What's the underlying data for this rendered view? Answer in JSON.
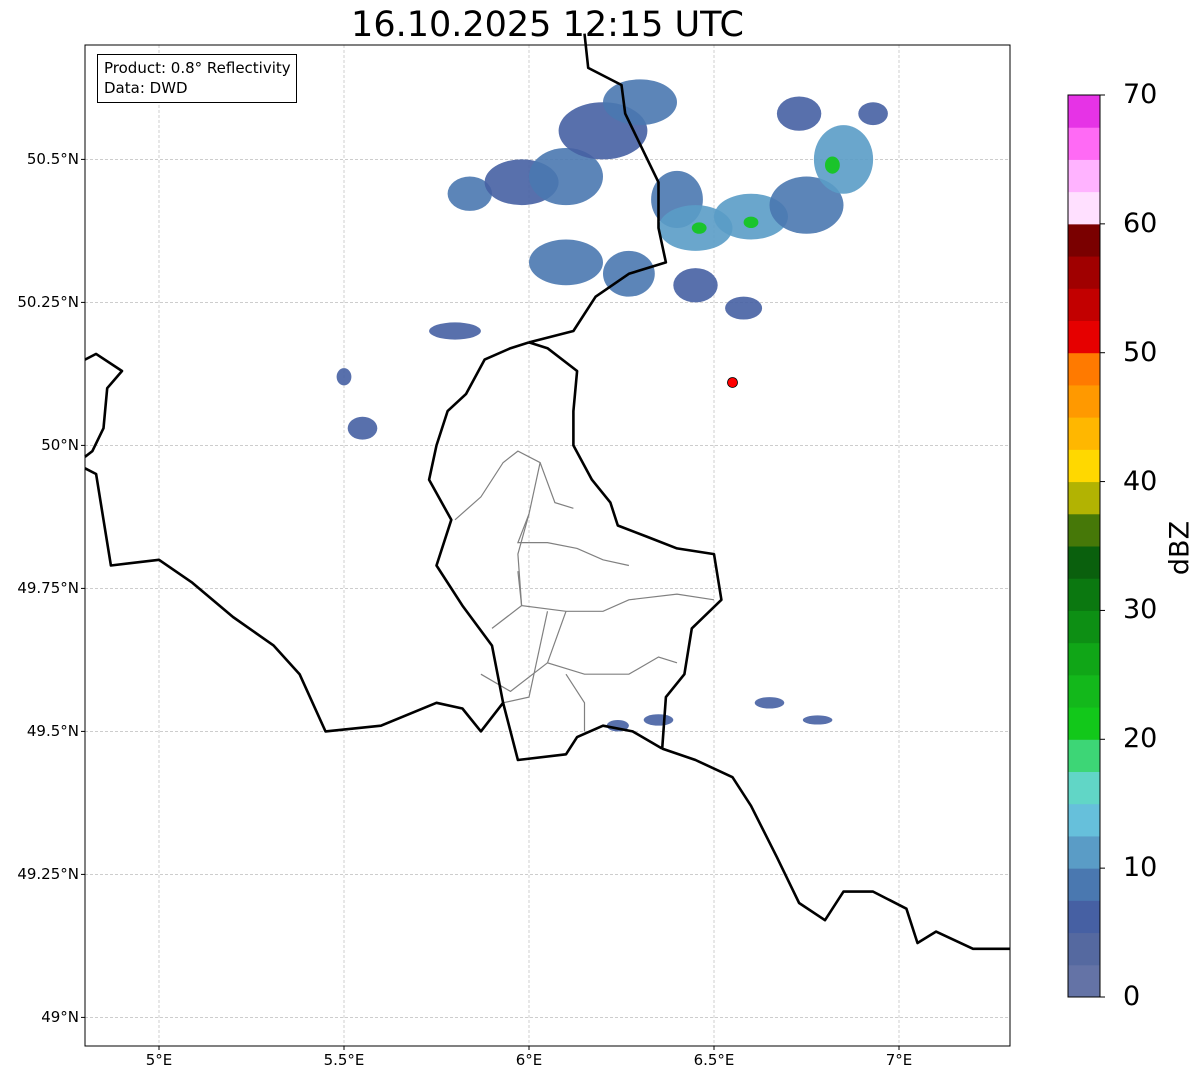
{
  "title": "16.10.2025 12:15 UTC",
  "info_box": {
    "product": "Product: 0.8° Reflectivity",
    "data": "Data: DWD"
  },
  "lat_ticks": [
    {
      "label": "50.5°N",
      "value": 50.5
    },
    {
      "label": "50.25°N",
      "value": 50.25
    },
    {
      "label": "50°N",
      "value": 50.0
    },
    {
      "label": "49.75°N",
      "value": 49.75
    },
    {
      "label": "49.5°N",
      "value": 49.5
    },
    {
      "label": "49.25°N",
      "value": 49.25
    },
    {
      "label": "49°N",
      "value": 49.0
    }
  ],
  "lon_ticks": [
    {
      "label": "5°E",
      "value": 5.0
    },
    {
      "label": "5.5°E",
      "value": 5.5
    },
    {
      "label": "6°E",
      "value": 6.0
    },
    {
      "label": "6.5°E",
      "value": 6.5
    },
    {
      "label": "7°E",
      "value": 7.0
    }
  ],
  "colorbar": {
    "label": "dBZ",
    "min": 0,
    "max": 70,
    "ticks": [
      {
        "label": "70",
        "value": 70
      },
      {
        "label": "60",
        "value": 60
      },
      {
        "label": "50",
        "value": 50
      },
      {
        "label": "40",
        "value": 40
      },
      {
        "label": "30",
        "value": 30
      },
      {
        "label": "20",
        "value": 20
      },
      {
        "label": "10",
        "value": 10
      },
      {
        "label": "0",
        "value": 0
      }
    ],
    "colors": [
      "#6473a6",
      "#5569a0",
      "#4660a3",
      "#4a78b0",
      "#5a9cc6",
      "#66c0db",
      "#61d6c6",
      "#3dd676",
      "#12c81a",
      "#13b81b",
      "#10a617",
      "#0d8f14",
      "#0b7810",
      "#0a600d",
      "#467808",
      "#b2b302",
      "#ffd800",
      "#ffb700",
      "#ff9900",
      "#ff7a00",
      "#e60000",
      "#c20000",
      "#a00000",
      "#7a0000",
      "#ffe0ff",
      "#ffb3ff",
      "#ff6af5",
      "#e633e6"
    ]
  },
  "map": {
    "extent_lon": [
      4.8,
      7.3
    ],
    "extent_lat": [
      48.95,
      50.7
    ],
    "station_marker": {
      "lon": 6.55,
      "lat": 50.11,
      "color": "#ff0000"
    },
    "borders": {
      "belgium_luxembourg_france": [
        [
          6.0,
          50.18
        ],
        [
          5.95,
          50.17
        ],
        [
          5.88,
          50.15
        ],
        [
          5.83,
          50.09
        ],
        [
          5.78,
          50.06
        ],
        [
          5.75,
          50.0
        ],
        [
          5.73,
          49.94
        ],
        [
          5.79,
          49.87
        ],
        [
          5.75,
          49.79
        ],
        [
          5.82,
          49.72
        ],
        [
          5.9,
          49.65
        ],
        [
          5.93,
          49.55
        ],
        [
          5.87,
          49.5
        ],
        [
          5.82,
          49.54
        ],
        [
          5.75,
          49.55
        ],
        [
          5.6,
          49.51
        ],
        [
          5.45,
          49.5
        ],
        [
          5.38,
          49.6
        ],
        [
          5.31,
          49.65
        ],
        [
          5.2,
          49.7
        ],
        [
          5.09,
          49.76
        ],
        [
          5.0,
          49.8
        ],
        [
          4.87,
          49.79
        ],
        [
          4.85,
          49.87
        ],
        [
          4.83,
          49.95
        ],
        [
          4.8,
          49.96
        ]
      ],
      "luxembourg_germany": [
        [
          6.0,
          50.18
        ],
        [
          6.05,
          50.17
        ],
        [
          6.13,
          50.13
        ],
        [
          6.12,
          50.06
        ],
        [
          6.12,
          50.0
        ],
        [
          6.17,
          49.94
        ],
        [
          6.22,
          49.9
        ],
        [
          6.24,
          49.86
        ],
        [
          6.32,
          49.84
        ],
        [
          6.4,
          49.82
        ],
        [
          6.5,
          49.81
        ],
        [
          6.52,
          49.73
        ],
        [
          6.44,
          49.68
        ],
        [
          6.42,
          49.6
        ],
        [
          6.37,
          49.56
        ],
        [
          6.36,
          49.47
        ]
      ],
      "luxembourg_france": [
        [
          6.36,
          49.47
        ],
        [
          6.28,
          49.5
        ],
        [
          6.2,
          49.51
        ],
        [
          6.13,
          49.49
        ],
        [
          6.1,
          49.46
        ],
        [
          5.97,
          49.45
        ],
        [
          5.93,
          49.55
        ]
      ],
      "germany_belgium": [
        [
          6.0,
          50.18
        ],
        [
          6.12,
          50.2
        ],
        [
          6.18,
          50.26
        ],
        [
          6.27,
          50.3
        ],
        [
          6.37,
          50.32
        ],
        [
          6.35,
          50.38
        ],
        [
          6.35,
          50.46
        ],
        [
          6.32,
          50.5
        ],
        [
          6.26,
          50.58
        ],
        [
          6.25,
          50.63
        ],
        [
          6.16,
          50.66
        ],
        [
          6.15,
          50.72
        ]
      ],
      "germany_france": [
        [
          6.36,
          49.47
        ],
        [
          6.45,
          49.45
        ],
        [
          6.55,
          49.42
        ],
        [
          6.6,
          49.37
        ],
        [
          6.67,
          49.28
        ],
        [
          6.73,
          49.2
        ],
        [
          6.8,
          49.17
        ],
        [
          6.85,
          49.22
        ],
        [
          6.93,
          49.22
        ],
        [
          7.02,
          49.19
        ],
        [
          7.05,
          49.13
        ],
        [
          7.1,
          49.15
        ],
        [
          7.2,
          49.12
        ],
        [
          7.3,
          49.12
        ]
      ],
      "belgium_france_west": [
        [
          4.8,
          50.15
        ],
        [
          4.83,
          50.16
        ],
        [
          4.9,
          50.13
        ],
        [
          4.86,
          50.1
        ],
        [
          4.85,
          50.03
        ],
        [
          4.82,
          49.99
        ],
        [
          4.8,
          49.98
        ]
      ]
    },
    "cantons": [
      [
        [
          5.8,
          49.87
        ],
        [
          5.87,
          49.91
        ],
        [
          5.93,
          49.97
        ],
        [
          5.97,
          49.99
        ],
        [
          6.03,
          49.97
        ],
        [
          6.07,
          49.9
        ],
        [
          6.12,
          49.89
        ]
      ],
      [
        [
          6.03,
          49.97
        ],
        [
          6.0,
          49.88
        ],
        [
          5.97,
          49.83
        ],
        [
          6.05,
          49.83
        ],
        [
          6.13,
          49.82
        ],
        [
          6.2,
          49.8
        ],
        [
          6.27,
          49.79
        ]
      ],
      [
        [
          6.0,
          49.88
        ],
        [
          5.97,
          49.81
        ],
        [
          5.98,
          49.72
        ],
        [
          5.9,
          49.68
        ]
      ],
      [
        [
          5.97,
          49.78
        ],
        [
          5.98,
          49.72
        ],
        [
          6.1,
          49.71
        ],
        [
          6.2,
          49.71
        ],
        [
          6.27,
          49.73
        ],
        [
          6.4,
          49.74
        ],
        [
          6.5,
          49.73
        ]
      ],
      [
        [
          6.05,
          49.71
        ],
        [
          6.02,
          49.62
        ],
        [
          6.0,
          49.56
        ],
        [
          5.93,
          49.55
        ]
      ],
      [
        [
          6.1,
          49.71
        ],
        [
          6.05,
          49.62
        ],
        [
          6.15,
          49.6
        ],
        [
          6.27,
          49.6
        ],
        [
          6.35,
          49.63
        ],
        [
          6.4,
          49.62
        ]
      ],
      [
        [
          6.05,
          49.62
        ],
        [
          5.95,
          49.57
        ],
        [
          5.87,
          49.6
        ]
      ],
      [
        [
          6.1,
          49.6
        ],
        [
          6.15,
          49.55
        ],
        [
          6.15,
          49.5
        ]
      ]
    ],
    "echoes": [
      {
        "lon": 5.84,
        "lat": 50.44,
        "rx": 0.06,
        "ry": 0.03,
        "dbz": 8
      },
      {
        "lon": 5.98,
        "lat": 50.46,
        "rx": 0.1,
        "ry": 0.04,
        "dbz": 7
      },
      {
        "lon": 6.1,
        "lat": 50.47,
        "rx": 0.1,
        "ry": 0.05,
        "dbz": 9
      },
      {
        "lon": 6.2,
        "lat": 50.55,
        "rx": 0.12,
        "ry": 0.05,
        "dbz": 7
      },
      {
        "lon": 6.3,
        "lat": 50.6,
        "rx": 0.1,
        "ry": 0.04,
        "dbz": 8
      },
      {
        "lon": 6.4,
        "lat": 50.43,
        "rx": 0.07,
        "ry": 0.05,
        "dbz": 9
      },
      {
        "lon": 6.45,
        "lat": 50.38,
        "rx": 0.1,
        "ry": 0.04,
        "dbz": 12
      },
      {
        "lon": 6.6,
        "lat": 50.4,
        "rx": 0.1,
        "ry": 0.04,
        "dbz": 10
      },
      {
        "lon": 6.75,
        "lat": 50.42,
        "rx": 0.1,
        "ry": 0.05,
        "dbz": 9
      },
      {
        "lon": 6.85,
        "lat": 50.5,
        "rx": 0.08,
        "ry": 0.06,
        "dbz": 10
      },
      {
        "lon": 6.1,
        "lat": 50.32,
        "rx": 0.1,
        "ry": 0.04,
        "dbz": 8
      },
      {
        "lon": 6.27,
        "lat": 50.3,
        "rx": 0.07,
        "ry": 0.04,
        "dbz": 9
      },
      {
        "lon": 6.45,
        "lat": 50.28,
        "rx": 0.06,
        "ry": 0.03,
        "dbz": 6
      },
      {
        "lon": 5.8,
        "lat": 50.2,
        "rx": 0.07,
        "ry": 0.015,
        "dbz": 6
      },
      {
        "lon": 6.73,
        "lat": 50.58,
        "rx": 0.06,
        "ry": 0.03,
        "dbz": 6
      },
      {
        "lon": 6.93,
        "lat": 50.58,
        "rx": 0.04,
        "ry": 0.02,
        "dbz": 6
      },
      {
        "lon": 6.58,
        "lat": 50.24,
        "rx": 0.05,
        "ry": 0.02,
        "dbz": 5
      },
      {
        "lon": 5.55,
        "lat": 50.03,
        "rx": 0.04,
        "ry": 0.02,
        "dbz": 5
      },
      {
        "lon": 5.5,
        "lat": 50.12,
        "rx": 0.02,
        "ry": 0.015,
        "dbz": 5
      },
      {
        "lon": 6.65,
        "lat": 49.55,
        "rx": 0.04,
        "ry": 0.01,
        "dbz": 5
      },
      {
        "lon": 6.78,
        "lat": 49.52,
        "rx": 0.04,
        "ry": 0.008,
        "dbz": 5
      },
      {
        "lon": 6.35,
        "lat": 49.52,
        "rx": 0.04,
        "ry": 0.01,
        "dbz": 5
      },
      {
        "lon": 6.24,
        "lat": 49.51,
        "rx": 0.03,
        "ry": 0.01,
        "dbz": 5
      },
      {
        "lon": 6.82,
        "lat": 50.49,
        "rx": 0.02,
        "ry": 0.015,
        "dbz": 22
      },
      {
        "lon": 6.6,
        "lat": 50.39,
        "rx": 0.02,
        "ry": 0.01,
        "dbz": 21
      },
      {
        "lon": 6.46,
        "lat": 50.38,
        "rx": 0.02,
        "ry": 0.01,
        "dbz": 20
      }
    ]
  }
}
